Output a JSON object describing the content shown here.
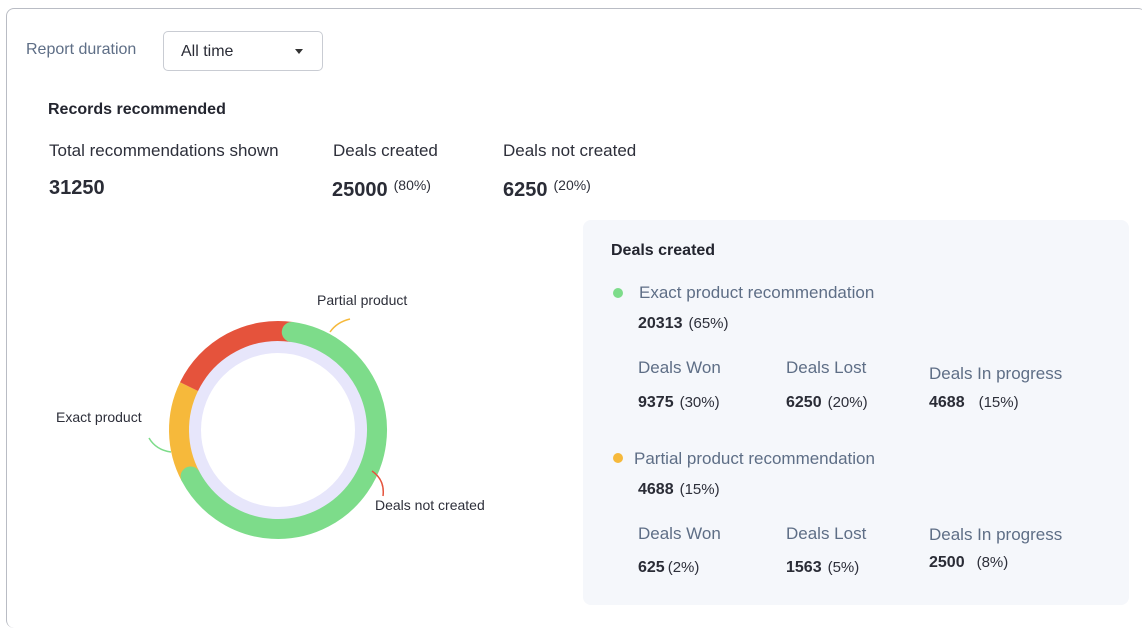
{
  "report": {
    "duration_label": "Report duration",
    "duration_value": "All time"
  },
  "records": {
    "title": "Records recommended",
    "stats": [
      {
        "label": "Total recommendations shown",
        "value": "31250",
        "pct": ""
      },
      {
        "label": "Deals created",
        "value": "25000",
        "pct": "(80%)"
      },
      {
        "label": "Deals not created",
        "value": "6250",
        "pct": "(20%)"
      }
    ]
  },
  "chart_data": {
    "type": "pie",
    "labels": [
      "Exact product",
      "Partial product",
      "Deals not created"
    ],
    "values": [
      20313,
      4688,
      6250
    ],
    "colors": [
      "#7ddc8a",
      "#f6b93b",
      "#e5533c"
    ]
  },
  "deals_created": {
    "title": "Deals created",
    "groups": [
      {
        "label": "Exact product recommendation",
        "color": "#7ddc8a",
        "value": "20313",
        "pct": "(65%)",
        "cells": [
          {
            "label": "Deals Won",
            "value": "9375",
            "pct": "(30%)"
          },
          {
            "label": "Deals Lost",
            "value": "6250",
            "pct": "(20%)"
          },
          {
            "label": "Deals In progress",
            "value": "4688",
            "pct": "(15%)"
          }
        ]
      },
      {
        "label": "Partial product recommendation",
        "color": "#f6b93b",
        "value": "4688",
        "pct": "(15%)",
        "cells": [
          {
            "label": "Deals Won",
            "value": "625",
            "pct": "(2%)"
          },
          {
            "label": "Deals Lost",
            "value": "1563",
            "pct": "(5%)"
          },
          {
            "label": "Deals In progress",
            "value": "2500",
            "pct": "(8%)"
          }
        ]
      }
    ]
  }
}
